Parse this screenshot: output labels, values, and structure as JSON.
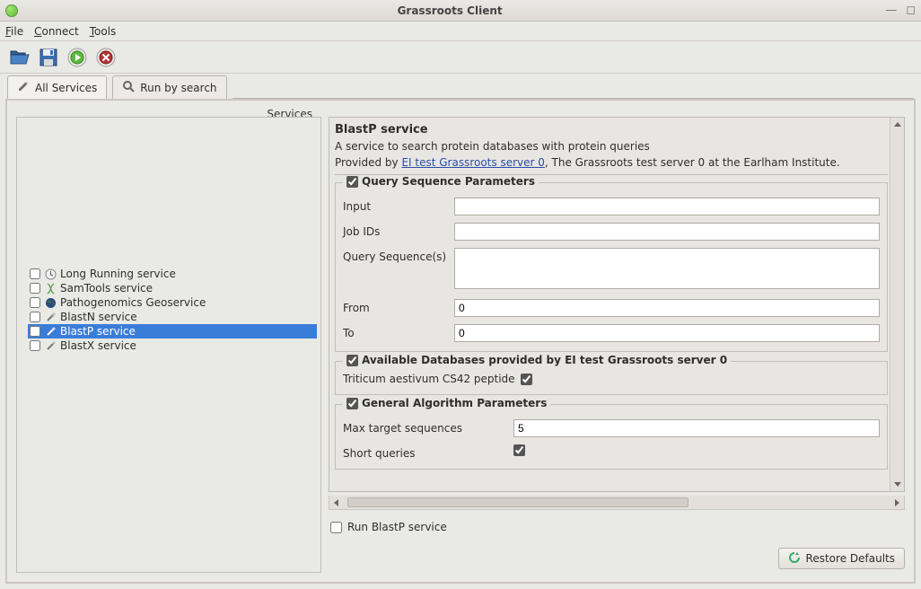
{
  "window": {
    "title": "Grassroots Client"
  },
  "menu": {
    "file": "File",
    "connect": "Connect",
    "tools": "Tools"
  },
  "tabs": {
    "all": "All Services",
    "search": "Run by search"
  },
  "sidebar_label": "Services",
  "services": [
    {
      "label": "Long Running service",
      "icon": "clock"
    },
    {
      "label": "SamTools service",
      "icon": "dna"
    },
    {
      "label": "Pathogenomics Geoservice",
      "icon": "globe"
    },
    {
      "label": "BlastN service",
      "icon": "wand"
    },
    {
      "label": "BlastP service",
      "icon": "wand",
      "selected": true
    },
    {
      "label": "BlastX service",
      "icon": "wand"
    }
  ],
  "detail": {
    "title": "BlastP service",
    "desc": "A service to search protein databases with protein queries",
    "provided_by_prefix": "Provided by ",
    "provided_by_link": "EI test Grassroots server 0",
    "provided_by_suffix": ", The Grassroots test server 0 at the Earlham Institute."
  },
  "group_query": {
    "legend": "Query Sequence Parameters",
    "input": "Input",
    "jobids": "Job IDs",
    "queryseq": "Query Sequence(s)",
    "from": "From",
    "from_value": "0",
    "to": "To",
    "to_value": "0"
  },
  "group_db": {
    "legend": "Available Databases provided by EI test Grassroots server 0",
    "item": "Triticum aestivum CS42 peptide"
  },
  "group_algo": {
    "legend": "General Algorithm Parameters",
    "max_target": "Max target sequences",
    "max_target_value": "5",
    "short_queries": "Short queries"
  },
  "run_label": "Run BlastP service",
  "restore": "Restore Defaults"
}
